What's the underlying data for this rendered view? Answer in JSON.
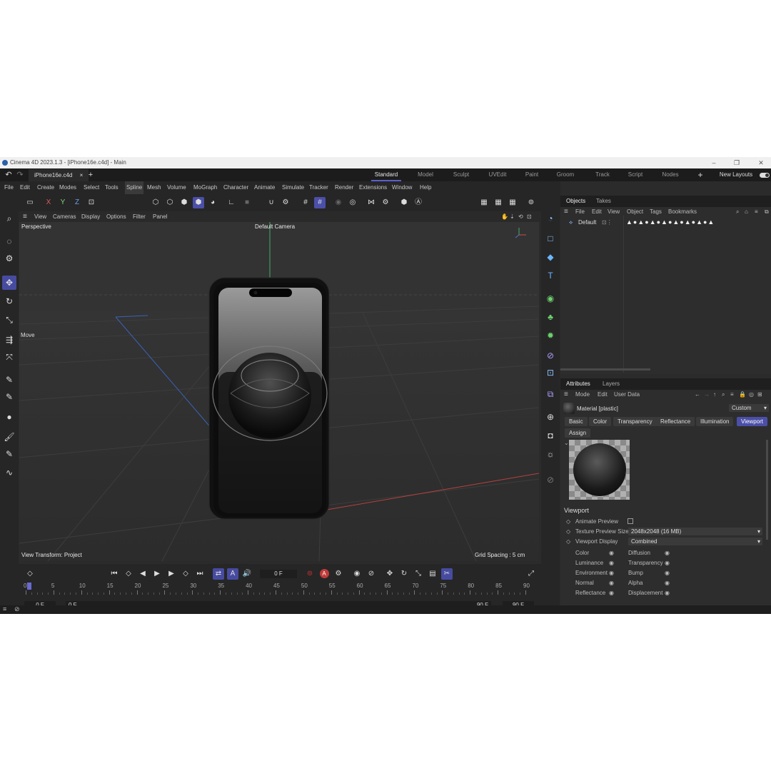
{
  "window": {
    "title": "Cinema 4D 2023.1.3 - [iPhone16e.c4d] - Main",
    "min": "–",
    "max": "❐",
    "close": "✕"
  },
  "file_tab": {
    "name": "iPhone16e.c4d",
    "close": "×",
    "add": "+"
  },
  "layouts": [
    "Standard",
    "Model",
    "Sculpt",
    "UVEdit",
    "Paint",
    "Groom",
    "Track",
    "Script",
    "Nodes"
  ],
  "layouts_active": "Standard",
  "new_layouts": "New Layouts",
  "menu": [
    "File",
    "Edit",
    "Create",
    "Modes",
    "Select",
    "Tools",
    "Spline",
    "Mesh",
    "Volume",
    "MoGraph",
    "Character",
    "Animate",
    "Simulate",
    "Tracker",
    "Render",
    "Extensions",
    "Window",
    "Help"
  ],
  "menu_active": "Spline",
  "axis_labels": [
    "X",
    "Y",
    "Z"
  ],
  "viewport_menu": [
    "View",
    "Cameras",
    "Display",
    "Options",
    "Filter",
    "Panel"
  ],
  "viewport": {
    "projection": "Perspective",
    "camera": "Default Camera",
    "move_label": "Move",
    "view_transform": "View Transform: Project",
    "grid_spacing": "Grid Spacing : 5 cm"
  },
  "timeline": {
    "current_frame": "0 F",
    "ticks": [
      "0",
      "5",
      "10",
      "15",
      "20",
      "25",
      "30",
      "35",
      "40",
      "45",
      "50",
      "55",
      "60",
      "65",
      "70",
      "75",
      "80",
      "85",
      "90"
    ],
    "start": "0 F",
    "start2": "0 F",
    "end": "90 F",
    "end2": "90 F",
    "key_a": "A"
  },
  "objects_panel": {
    "tabs": [
      "Objects",
      "Takes"
    ],
    "menu": [
      "File",
      "Edit",
      "View",
      "Object",
      "Tags",
      "Bookmarks"
    ],
    "item": "Default"
  },
  "attributes_panel": {
    "tabs": [
      "Attributes",
      "Layers"
    ],
    "menu": [
      "Mode",
      "Edit",
      "User Data"
    ],
    "material": "Material [plastic]",
    "custom": "Custom",
    "buttons": [
      "Basic",
      "Color",
      "Transparency",
      "Reflectance",
      "Illumination",
      "Viewport",
      "Assign"
    ],
    "active": "Viewport",
    "section": "Viewport",
    "animate_preview": "Animate Preview",
    "texture_preview_size": "Texture Preview Size",
    "texture_preview_value": "2048x2048 (16 MB)",
    "viewport_display": "Viewport Display",
    "viewport_display_value": "Combined",
    "channels_left": [
      "Color",
      "Luminance",
      "Environment",
      "Normal",
      "Reflectance"
    ],
    "channels_right": [
      "Diffusion",
      "Transparency",
      "Bump",
      "Alpha",
      "Displacement"
    ]
  },
  "colors": {
    "accent": "#4b4fa8",
    "bg": "#2b2b2b",
    "viewport": "#333333"
  }
}
